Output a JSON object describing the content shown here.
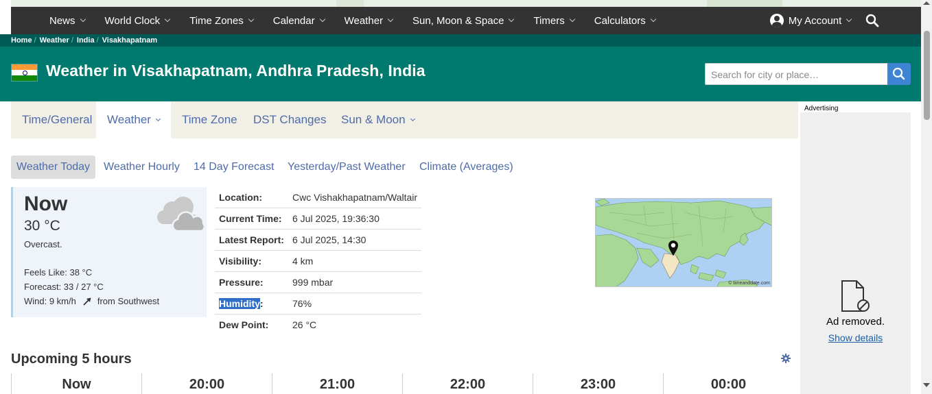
{
  "nav": {
    "items": [
      {
        "label": "News"
      },
      {
        "label": "World Clock"
      },
      {
        "label": "Time Zones"
      },
      {
        "label": "Calendar"
      },
      {
        "label": "Weather"
      },
      {
        "label": "Sun, Moon & Space"
      },
      {
        "label": "Timers"
      },
      {
        "label": "Calculators"
      }
    ],
    "account_label": "My Account"
  },
  "breadcrumb": [
    "Home",
    "Weather",
    "India",
    "Visakhapatnam"
  ],
  "header": {
    "title": "Weather in Visakhapatnam, Andhra Pradesh, India",
    "search_placeholder": "Search for city or place…"
  },
  "tabs": [
    {
      "label": "Time/General"
    },
    {
      "label": "Weather"
    },
    {
      "label": "Time Zone"
    },
    {
      "label": "DST Changes"
    },
    {
      "label": "Sun & Moon"
    }
  ],
  "subtabs": [
    {
      "label": "Weather Today"
    },
    {
      "label": "Weather Hourly"
    },
    {
      "label": "14 Day Forecast"
    },
    {
      "label": "Yesterday/Past Weather"
    },
    {
      "label": "Climate (Averages)"
    }
  ],
  "now": {
    "title": "Now",
    "temp": "30 °C",
    "condition": "Overcast.",
    "feels_like": "Feels Like: 38 °C",
    "forecast": "Forecast: 33 / 27 °C",
    "wind": "Wind: 9 km/h",
    "wind_dir": "from Southwest"
  },
  "details": {
    "location_label": "Location:",
    "location": "Cwc Vishakhapatnam/Waltair",
    "current_time_label": "Current Time:",
    "current_time": "6 Jul 2025, 19:36:30",
    "latest_report_label": "Latest Report:",
    "latest_report": "6 Jul 2025, 14:30",
    "visibility_label": "Visibility:",
    "visibility": "4 km",
    "pressure_label": "Pressure:",
    "pressure": "999 mbar",
    "humidity_label": "Humidity",
    "humidity": "76%",
    "dew_point_label": "Dew Point:",
    "dew_point": "26 °C"
  },
  "map_credit": "© timeanddate.com",
  "ad": {
    "label": "Advertising",
    "removed_text": "Ad removed.",
    "show_details": "Show details"
  },
  "upcoming": {
    "title": "Upcoming 5 hours",
    "hours": [
      "Now",
      "20:00",
      "21:00",
      "22:00",
      "23:00",
      "00:00"
    ]
  }
}
